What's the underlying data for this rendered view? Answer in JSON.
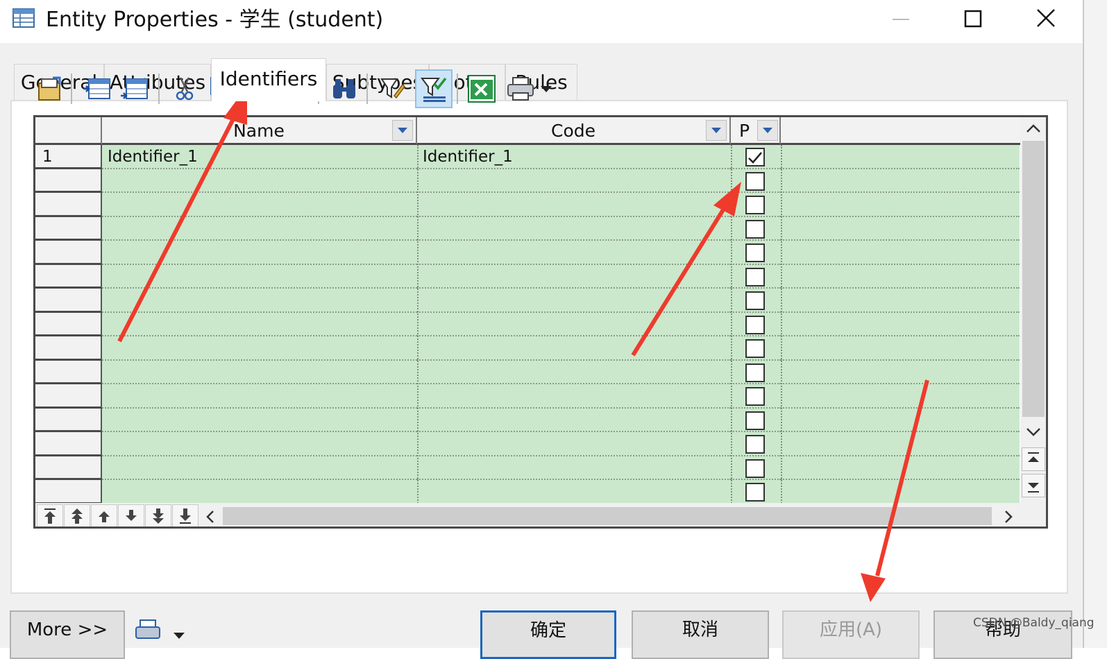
{
  "window": {
    "title": "Entity Properties - 学生 (student)",
    "controls": [
      "minimize",
      "maximize",
      "close"
    ]
  },
  "tabs": [
    {
      "label": "General",
      "active": false
    },
    {
      "label": "Attributes",
      "active": false
    },
    {
      "label": "Identifiers",
      "active": true
    },
    {
      "label": "Subtypes",
      "active": false
    },
    {
      "label": "Notes",
      "active": false
    },
    {
      "label": "Rules",
      "active": false
    }
  ],
  "toolbar": {
    "icons": [
      "properties-icon",
      "add-row-icon",
      "insert-row-icon",
      "cut-icon",
      "copy-icon",
      "paste-icon",
      "delete-icon",
      "find-icon",
      "filter-icon",
      "filter-active-icon",
      "excel-export-icon",
      "print-icon",
      "dropdown-icon"
    ],
    "selected": "filter-active-icon"
  },
  "grid": {
    "columns": [
      "Name",
      "Code",
      "P"
    ],
    "rows": [
      {
        "num": "1",
        "name": "Identifier_1",
        "code": "Identifier_1",
        "primary": true
      },
      {
        "num": "",
        "name": "",
        "code": "",
        "primary": false
      },
      {
        "num": "",
        "name": "",
        "code": "",
        "primary": false
      },
      {
        "num": "",
        "name": "",
        "code": "",
        "primary": false
      },
      {
        "num": "",
        "name": "",
        "code": "",
        "primary": false
      },
      {
        "num": "",
        "name": "",
        "code": "",
        "primary": false
      },
      {
        "num": "",
        "name": "",
        "code": "",
        "primary": false
      },
      {
        "num": "",
        "name": "",
        "code": "",
        "primary": false
      },
      {
        "num": "",
        "name": "",
        "code": "",
        "primary": false
      },
      {
        "num": "",
        "name": "",
        "code": "",
        "primary": false
      },
      {
        "num": "",
        "name": "",
        "code": "",
        "primary": false
      },
      {
        "num": "",
        "name": "",
        "code": "",
        "primary": false
      },
      {
        "num": "",
        "name": "",
        "code": "",
        "primary": false
      },
      {
        "num": "",
        "name": "",
        "code": "",
        "primary": false
      },
      {
        "num": "",
        "name": "",
        "code": "",
        "primary": false
      }
    ],
    "row_colors": {
      "data": "#cbe8cc",
      "header": "#f2f2f2"
    }
  },
  "buttons": {
    "more": "More >>",
    "ok": "确定",
    "cancel": "取消",
    "apply": "应用(A)",
    "help": "帮助"
  },
  "watermark": "CSDN @Baldy_qiang",
  "annotation_color": "#ee3b2c"
}
